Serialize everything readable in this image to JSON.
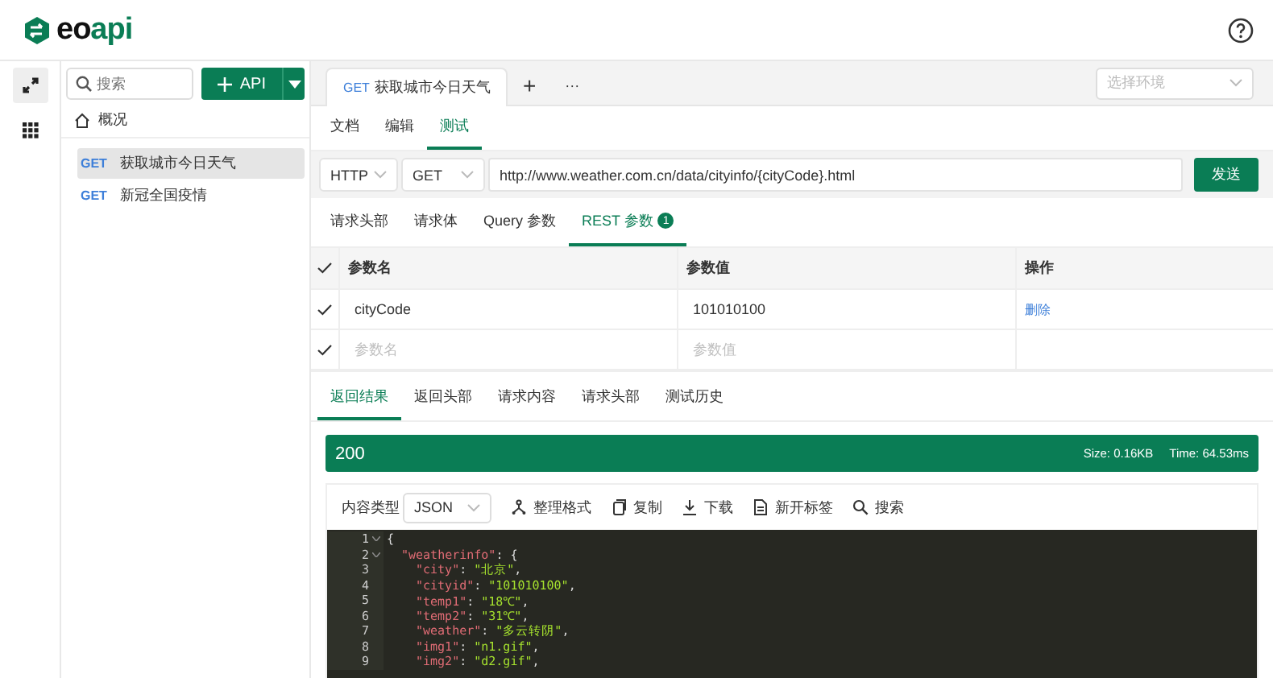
{
  "logo": {
    "text": "eoapi"
  },
  "rail": [
    {
      "selected": true
    },
    {
      "selected": false
    }
  ],
  "sidebar": {
    "search": {
      "placeholder": "搜索"
    },
    "new_button": "API",
    "overview": "概况",
    "items": [
      {
        "method": "GET",
        "name": "获取城市今日天气",
        "selected": true
      },
      {
        "method": "GET",
        "name": "新冠全国疫情",
        "selected": false
      }
    ]
  },
  "tabs": [
    {
      "method": "GET",
      "title": "获取城市今日天气",
      "selected": true
    }
  ],
  "tab_add": "+",
  "tab_more": "···",
  "environment": {
    "placeholder": "选择环境"
  },
  "mode_tabs": [
    {
      "label": "文档",
      "selected": false
    },
    {
      "label": "编辑",
      "selected": false
    },
    {
      "label": "测试",
      "selected": true
    }
  ],
  "request": {
    "protocol": "HTTP",
    "method": "GET",
    "url": "http://www.weather.com.cn/data/cityinfo/{cityCode}.html",
    "send": "发送"
  },
  "param_tabs": [
    {
      "label": "请求头部",
      "selected": false
    },
    {
      "label": "请求体",
      "selected": false
    },
    {
      "label": "Query 参数",
      "selected": false
    },
    {
      "label": "REST 参数",
      "selected": true,
      "badge": "1"
    }
  ],
  "params_table": {
    "all_checked": true,
    "columns": [
      "参数名",
      "参数值",
      "操作"
    ],
    "rows": [
      {
        "checked": true,
        "name": "cityCode",
        "value": "101010100",
        "action": "删除"
      },
      {
        "checked": true,
        "name_placeholder": "参数名",
        "value_placeholder": "参数值"
      }
    ]
  },
  "response_tabs": [
    {
      "label": "返回结果",
      "selected": true
    },
    {
      "label": "返回头部",
      "selected": false
    },
    {
      "label": "请求内容",
      "selected": false
    },
    {
      "label": "请求头部",
      "selected": false
    },
    {
      "label": "测试历史",
      "selected": false
    }
  ],
  "status": {
    "code": "200",
    "size": "Size: 0.16KB",
    "time": "Time: 64.53ms"
  },
  "toolbar": {
    "content_type_label": "内容类型",
    "content_type": "JSON",
    "actions": [
      {
        "label": "整理格式"
      },
      {
        "label": "复制"
      },
      {
        "label": "下载"
      },
      {
        "label": "新开标签"
      },
      {
        "label": "搜索"
      }
    ]
  },
  "code": [
    {
      "number": "1",
      "fold": true,
      "tokens": [
        {
          "kind": "punct",
          "text": "{"
        }
      ]
    },
    {
      "number": "2",
      "fold": true,
      "tokens": [
        {
          "kind": "key",
          "text": "\"weatherinfo\""
        },
        {
          "kind": "punct",
          "text": ": {"
        }
      ]
    },
    {
      "number": "3",
      "fold": false,
      "tokens": [
        {
          "kind": "key",
          "text": "\"city\""
        },
        {
          "kind": "punct",
          "text": ": "
        },
        {
          "kind": "string",
          "text": "\"北京\""
        },
        {
          "kind": "punct",
          "text": ","
        }
      ]
    },
    {
      "number": "4",
      "fold": false,
      "tokens": [
        {
          "kind": "key",
          "text": "\"cityid\""
        },
        {
          "kind": "punct",
          "text": ": "
        },
        {
          "kind": "string",
          "text": "\"101010100\""
        },
        {
          "kind": "punct",
          "text": ","
        }
      ]
    },
    {
      "number": "5",
      "fold": false,
      "tokens": [
        {
          "kind": "key",
          "text": "\"temp1\""
        },
        {
          "kind": "punct",
          "text": ": "
        },
        {
          "kind": "string",
          "text": "\"18℃\""
        },
        {
          "kind": "punct",
          "text": ","
        }
      ]
    },
    {
      "number": "6",
      "fold": false,
      "tokens": [
        {
          "kind": "key",
          "text": "\"temp2\""
        },
        {
          "kind": "punct",
          "text": ": "
        },
        {
          "kind": "string",
          "text": "\"31℃\""
        },
        {
          "kind": "punct",
          "text": ","
        }
      ]
    },
    {
      "number": "7",
      "fold": false,
      "tokens": [
        {
          "kind": "key",
          "text": "\"weather\""
        },
        {
          "kind": "punct",
          "text": ": "
        },
        {
          "kind": "string",
          "text": "\"多云转阴\""
        },
        {
          "kind": "punct",
          "text": ","
        }
      ]
    },
    {
      "number": "8",
      "fold": false,
      "tokens": [
        {
          "kind": "key",
          "text": "\"img1\""
        },
        {
          "kind": "punct",
          "text": ": "
        },
        {
          "kind": "string",
          "text": "\"n1.gif\""
        },
        {
          "kind": "punct",
          "text": ","
        }
      ]
    },
    {
      "number": "9",
      "fold": false,
      "tokens": [
        {
          "kind": "key",
          "text": "\"img2\""
        },
        {
          "kind": "punct",
          "text": ": "
        },
        {
          "kind": "string",
          "text": "\"d2.gif\""
        },
        {
          "kind": "punct",
          "text": ","
        }
      ]
    }
  ]
}
